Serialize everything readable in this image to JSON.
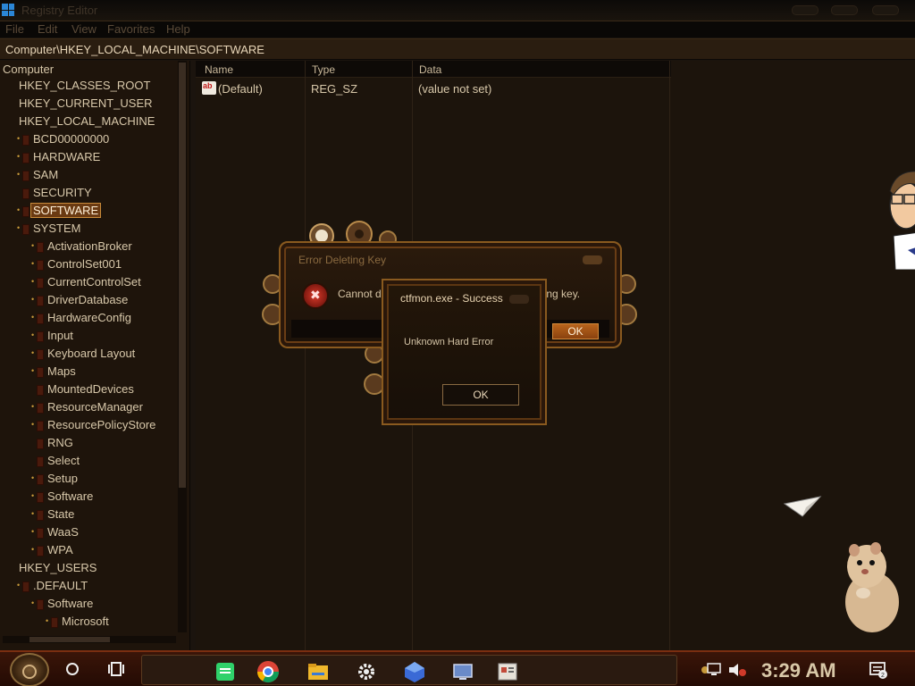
{
  "window": {
    "title": "Registry Editor",
    "address": "Computer\\HKEY_LOCAL_MACHINE\\SOFTWARE"
  },
  "menu": [
    "File",
    "Edit",
    "View",
    "Favorites",
    "Help"
  ],
  "tree": {
    "root": "Computer",
    "nodes": [
      {
        "label": "HKEY_CLASSES_ROOT",
        "level": 1
      },
      {
        "label": "HKEY_CURRENT_USER",
        "level": 1
      },
      {
        "label": "HKEY_LOCAL_MACHINE",
        "level": 1
      },
      {
        "label": "BCD00000000",
        "level": 2
      },
      {
        "label": "HARDWARE",
        "level": 2
      },
      {
        "label": "SAM",
        "level": 2
      },
      {
        "label": "SECURITY",
        "level": 2
      },
      {
        "label": "SOFTWARE",
        "level": 2,
        "selected": true
      },
      {
        "label": "SYSTEM",
        "level": 2
      },
      {
        "label": "ActivationBroker",
        "level": 3
      },
      {
        "label": "ControlSet001",
        "level": 3
      },
      {
        "label": "CurrentControlSet",
        "level": 3
      },
      {
        "label": "DriverDatabase",
        "level": 3
      },
      {
        "label": "HardwareConfig",
        "level": 3
      },
      {
        "label": "Input",
        "level": 3
      },
      {
        "label": "Keyboard Layout",
        "level": 3
      },
      {
        "label": "Maps",
        "level": 3
      },
      {
        "label": "MountedDevices",
        "level": 3
      },
      {
        "label": "ResourceManager",
        "level": 3
      },
      {
        "label": "ResourcePolicyStore",
        "level": 3
      },
      {
        "label": "RNG",
        "level": 3
      },
      {
        "label": "Select",
        "level": 3
      },
      {
        "label": "Setup",
        "level": 3
      },
      {
        "label": "Software",
        "level": 3
      },
      {
        "label": "State",
        "level": 3
      },
      {
        "label": "WaaS",
        "level": 3
      },
      {
        "label": "WPA",
        "level": 3
      },
      {
        "label": "HKEY_USERS",
        "level": 1
      },
      {
        "label": ".DEFAULT",
        "level": 2
      },
      {
        "label": "Software",
        "level": 3
      },
      {
        "label": "Microsoft",
        "level": 4
      }
    ]
  },
  "list": {
    "columns": [
      "Name",
      "Type",
      "Data"
    ],
    "rows": [
      {
        "icon": "ab",
        "name": "(Default)",
        "type": "REG_SZ",
        "data": "(value not set)"
      }
    ]
  },
  "dialog_error": {
    "title": "Error Deleting Key",
    "message_part_a": "Cannot de",
    "message_part_b": "leting key.",
    "ok_label": "OK",
    "icon": "error-icon"
  },
  "dialog_success": {
    "title": "ctfmon.exe - Success",
    "message": "Unknown Hard Error",
    "ok_label": "OK"
  },
  "taskbar": {
    "clock": "3:29 AM",
    "apps": [
      "messaging-icon",
      "chrome-icon",
      "file-explorer-icon",
      "settings-icon",
      "app-icon",
      "remote-desktop-icon",
      "registry-editor-icon"
    ],
    "notification_count": "2"
  }
}
